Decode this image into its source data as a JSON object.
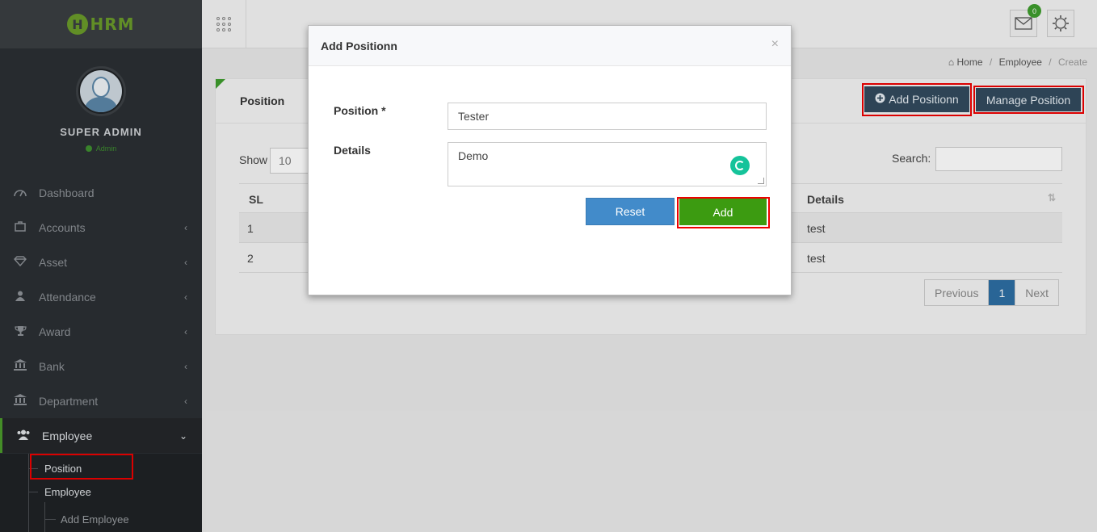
{
  "app": {
    "logo_text": "HRM",
    "logo_letter": "H"
  },
  "sidebar": {
    "profile": {
      "name": "SUPER ADMIN",
      "role": "Admin"
    },
    "items": [
      {
        "label": "Dashboard",
        "icon": "dashboard-icon"
      },
      {
        "label": "Accounts",
        "icon": "briefcase-icon"
      },
      {
        "label": "Asset",
        "icon": "diamond-icon"
      },
      {
        "label": "Attendance",
        "icon": "user-icon"
      },
      {
        "label": "Award",
        "icon": "trophy-icon"
      },
      {
        "label": "Bank",
        "icon": "bank-icon"
      },
      {
        "label": "Department",
        "icon": "bank-icon"
      },
      {
        "label": "Employee",
        "icon": "users-icon"
      }
    ],
    "sub_items": [
      {
        "label": "Position"
      },
      {
        "label": "Employee"
      },
      {
        "label": "Add Employee"
      }
    ]
  },
  "topbar": {
    "notification_count": "0"
  },
  "breadcrumb": {
    "home": "Home",
    "section": "Employee",
    "current": "Create"
  },
  "panel": {
    "title": "Position",
    "add_button": "Add Positionn",
    "manage_button": "Manage Position"
  },
  "table": {
    "show_label": "Show",
    "show_value": "10",
    "search_label": "Search:",
    "columns": [
      "SL",
      "Details"
    ],
    "rows": [
      {
        "sl": "1",
        "details": "test"
      },
      {
        "sl": "2",
        "details": "test"
      }
    ]
  },
  "pagination": {
    "previous": "Previous",
    "current": "1",
    "next": "Next"
  },
  "modal": {
    "title": "Add Positionn",
    "close": "×",
    "position_label": "Position *",
    "position_value": "Tester",
    "details_label": "Details",
    "details_value": "Demo",
    "reset_button": "Reset",
    "add_button": "Add"
  },
  "colors": {
    "sidebar_bg": "#2b2f33",
    "accent_green": "#3c9b11",
    "dark_button": "#324a5e",
    "reset_blue": "#428bca",
    "highlight_red": "#e00000"
  }
}
